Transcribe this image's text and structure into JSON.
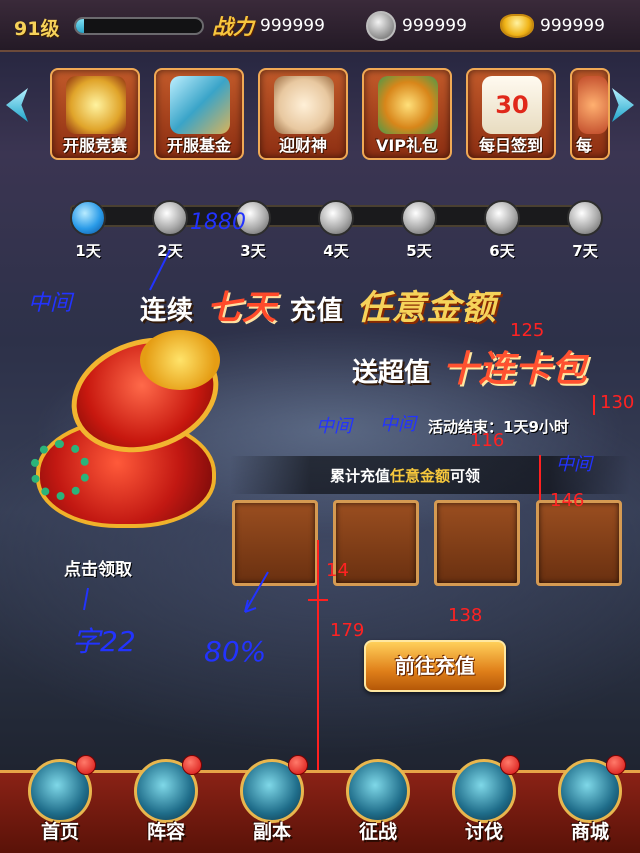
{
  "topbar": {
    "level": "91级",
    "exp_fraction": 0.06,
    "power_label": "战力",
    "power_value": "999999",
    "silver_value": "999999",
    "gold_value": "999999"
  },
  "events": [
    {
      "label": "开服竞赛",
      "icon": "trophy-icon",
      "color": "#e8c85a"
    },
    {
      "label": "开服基金",
      "icon": "scrolls-icon",
      "color": "#4ab6d8"
    },
    {
      "label": "迎财神",
      "icon": "fortune-god-icon",
      "color": "#f0d7a8"
    },
    {
      "label": "VIP礼包",
      "icon": "gift-bag-icon",
      "color": "#d86a2a"
    },
    {
      "label": "每日签到",
      "icon": "calendar-icon",
      "color": "#f4f0e0",
      "badge_text": "30"
    },
    {
      "label": "每",
      "icon": "partial-icon",
      "color": "#c04a2a"
    }
  ],
  "days": [
    "1天",
    "2天",
    "3天",
    "4天",
    "5天",
    "6天",
    "7天"
  ],
  "active_day_index": 0,
  "headline": {
    "part1": "连续",
    "part2": "七天",
    "part3": "充值",
    "part4": "任意金额"
  },
  "subheadline": {
    "part1": "送超值",
    "part2": "十连卡包"
  },
  "end_time": "活动结束：1天9小时",
  "reward_caption": {
    "part1": "累计充值",
    "part2": "任意金额",
    "part3": "可领"
  },
  "claim_label": "点击领取",
  "goto_button": "前往充值",
  "bottom_nav": [
    {
      "label": "首页",
      "icon": "home-icon",
      "badge": true
    },
    {
      "label": "阵容",
      "icon": "lineup-icon",
      "badge": true
    },
    {
      "label": "副本",
      "icon": "dungeon-icon",
      "badge": true
    },
    {
      "label": "征战",
      "icon": "battle-icon",
      "badge": false
    },
    {
      "label": "讨伐",
      "icon": "crusade-icon",
      "badge": true
    },
    {
      "label": "商城",
      "icon": "shop-icon",
      "badge": true
    }
  ],
  "annotations": {
    "a1": "1880",
    "a2": "中间",
    "a3": "125",
    "a4": "130",
    "a5": "中间",
    "a6": "中间",
    "a7": "116",
    "a8": "中间",
    "a9": "146",
    "a10": "14",
    "a11": "179",
    "a12": "138",
    "a13": "字22",
    "a14": "80%"
  }
}
